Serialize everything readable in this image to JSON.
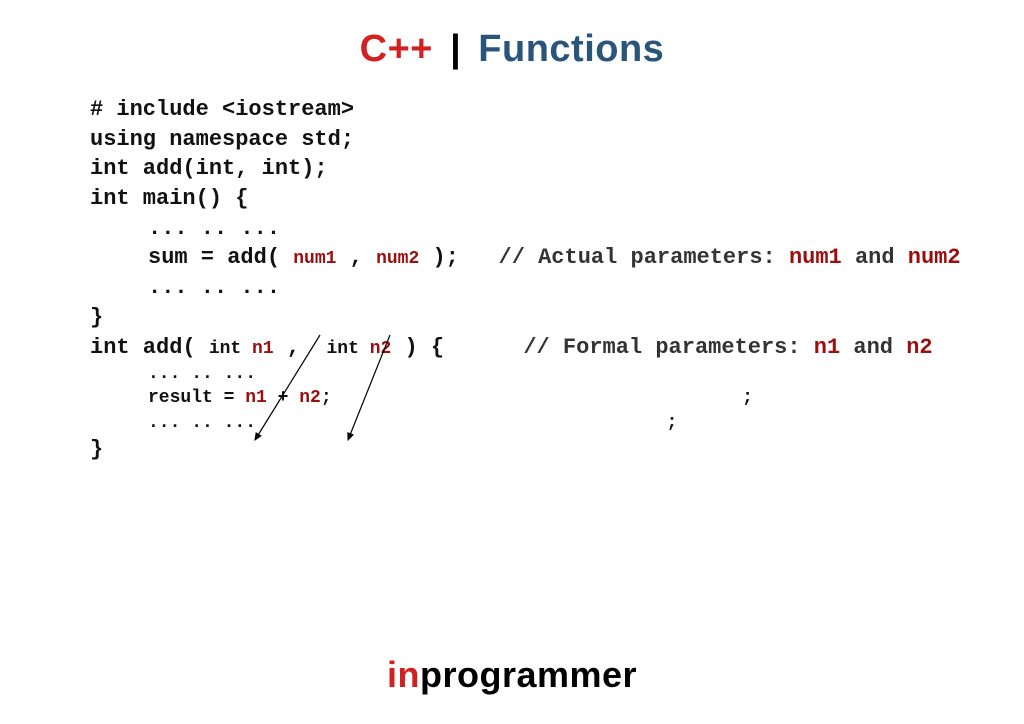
{
  "title": {
    "cpp": "C++",
    "pipe": "|",
    "functions": "Functions"
  },
  "code": {
    "l1": "# include <iostream>",
    "l2": "using namespace std;",
    "l3": "",
    "l4": "int add(int, int);",
    "l5": "",
    "l6": "int main() {",
    "l7": "... .. ...",
    "l8_pre": "sum = add( ",
    "l8_num1": "num1",
    "l8_comma": " , ",
    "l8_num2": "num2",
    "l8_post": " );   ",
    "l8_comment_pre": "// Actual parameters: ",
    "l8_c_num1": "num1",
    "l8_c_and": " and ",
    "l8_c_num2": "num2",
    "l9": "... .. ...",
    "l10": "}",
    "l11": "",
    "l12_pre": "int add( ",
    "l12_int1": "int ",
    "l12_n1": "n1",
    "l12_comma": " ,  ",
    "l12_int2": "int ",
    "l12_n2": "n2",
    "l12_post": " ) {",
    "l12_spacer": "      ",
    "l12_comment_pre": "// Formal parameters: ",
    "l12_c_n1": "n1",
    "l12_c_and": " and ",
    "l12_c_n2": "n2",
    "l13": "... .. ...",
    "l14_pre": "result = ",
    "l14_n1": "n1",
    "l14_plus": " + ",
    "l14_n2": "n2",
    "l14_post": ";",
    "l14_semi_r": "                                      ;",
    "l15": "... .. ...",
    "l15_semi_r": "                                      ;",
    "l16": "}"
  },
  "footer": {
    "in": "in",
    "programmer": "programmer"
  }
}
